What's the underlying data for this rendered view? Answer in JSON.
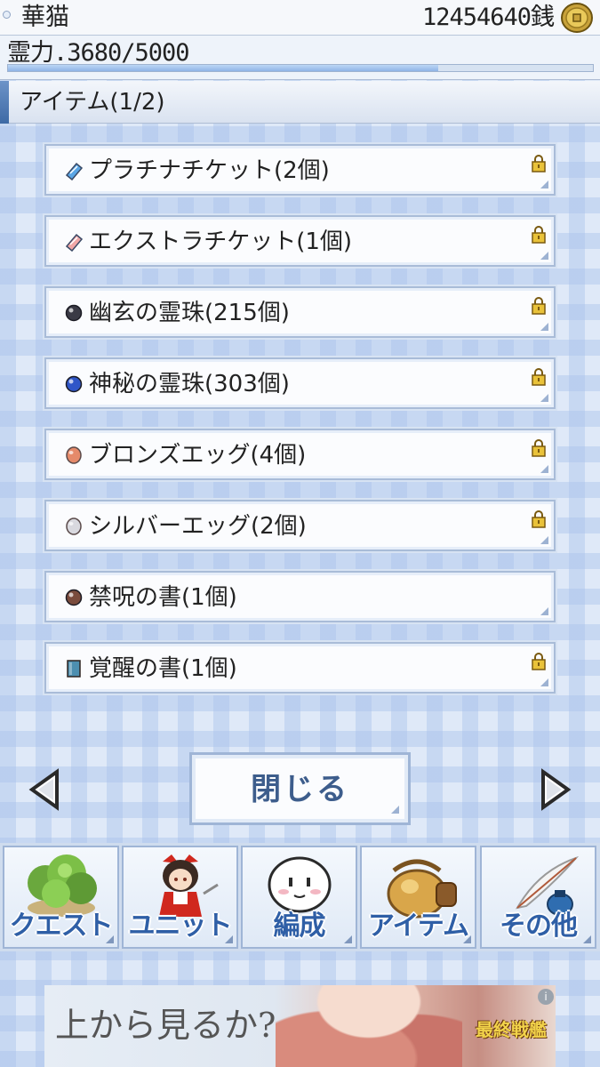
{
  "header": {
    "player_name": "華猫",
    "money": "12454640銭",
    "spirit_label": "霊力.3680/5000",
    "spirit_current": 3680,
    "spirit_max": 5000,
    "section_title": "アイテム(1/2)"
  },
  "items": [
    {
      "label": "プラチナチケット(2個)",
      "icon": "platinum-ticket-icon",
      "color": "#5aa6e6",
      "locked": true
    },
    {
      "label": "エクストラチケット(1個)",
      "icon": "extra-ticket-icon",
      "color": "#f0a7a7",
      "locked": true
    },
    {
      "label": "幽玄の霊珠(215個)",
      "icon": "dark-orb-icon",
      "color": "#3a3a45",
      "locked": true
    },
    {
      "label": "神秘の霊珠(303個)",
      "icon": "mystic-orb-icon",
      "color": "#2f56c8",
      "locked": true
    },
    {
      "label": "ブロンズエッグ(4個)",
      "icon": "bronze-egg-icon",
      "color": "#e58a6a",
      "locked": true
    },
    {
      "label": "シルバーエッグ(2個)",
      "icon": "silver-egg-icon",
      "color": "#d9d9df",
      "locked": true
    },
    {
      "label": "禁呪の書(1個)",
      "icon": "forbidden-book-icon",
      "color": "#7a4b3c",
      "locked": false
    },
    {
      "label": "覚醒の書(1個)",
      "icon": "awakening-book-icon",
      "color": "#4d8fb0",
      "locked": true
    }
  ],
  "controls": {
    "close_label": "閉じる"
  },
  "menu": [
    {
      "label": "クエスト",
      "icon": "tree-icon"
    },
    {
      "label": "ユニット",
      "icon": "shrine-maiden-icon"
    },
    {
      "label": "編成",
      "icon": "ghost-face-icon"
    },
    {
      "label": "アイテム",
      "icon": "bag-icon"
    },
    {
      "label": "その他",
      "icon": "quill-pen-icon"
    }
  ],
  "ad": {
    "text": "上から見るか?",
    "logo": "最終戦艦",
    "info": "i"
  },
  "colors": {
    "accent": "#3e6aa5",
    "menu_text": "#2f5fa6",
    "close_text": "#3d5d8c"
  }
}
